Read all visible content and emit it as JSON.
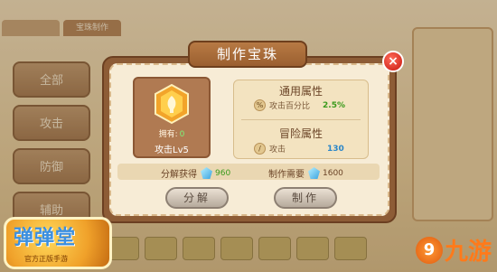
{
  "background": {
    "tabs": [
      "",
      "宝珠制作"
    ],
    "side_buttons": [
      "全部",
      "攻击",
      "防御",
      "辅助"
    ]
  },
  "logo": {
    "text": "弹弹堂",
    "subtitle": "官方正版手游"
  },
  "watermark": {
    "text": "九游"
  },
  "dialog": {
    "title": "制作宝珠",
    "close_label": "×",
    "item": {
      "own_label": "拥有:",
      "own_count": "0",
      "name": "攻击Lv5",
      "icon": "gem-icon"
    },
    "general_attr": {
      "heading": "通用属性",
      "label": "攻击百分比",
      "value": "2.5%",
      "icon": "percent-icon"
    },
    "adventure_attr": {
      "heading": "冒险属性",
      "label": "攻击",
      "value": "130",
      "icon": "attack-icon"
    },
    "decompose_gain": {
      "label": "分解获得",
      "value": "960",
      "icon": "crystal-icon"
    },
    "craft_cost": {
      "label": "制作需要",
      "value": "1600",
      "icon": "crystal-icon"
    },
    "buttons": {
      "decompose": "分解",
      "craft": "制作"
    }
  },
  "colors": {
    "accent_green": "#3a9a1c",
    "accent_blue": "#2a86c8",
    "modal_border": "#8d5c36"
  }
}
